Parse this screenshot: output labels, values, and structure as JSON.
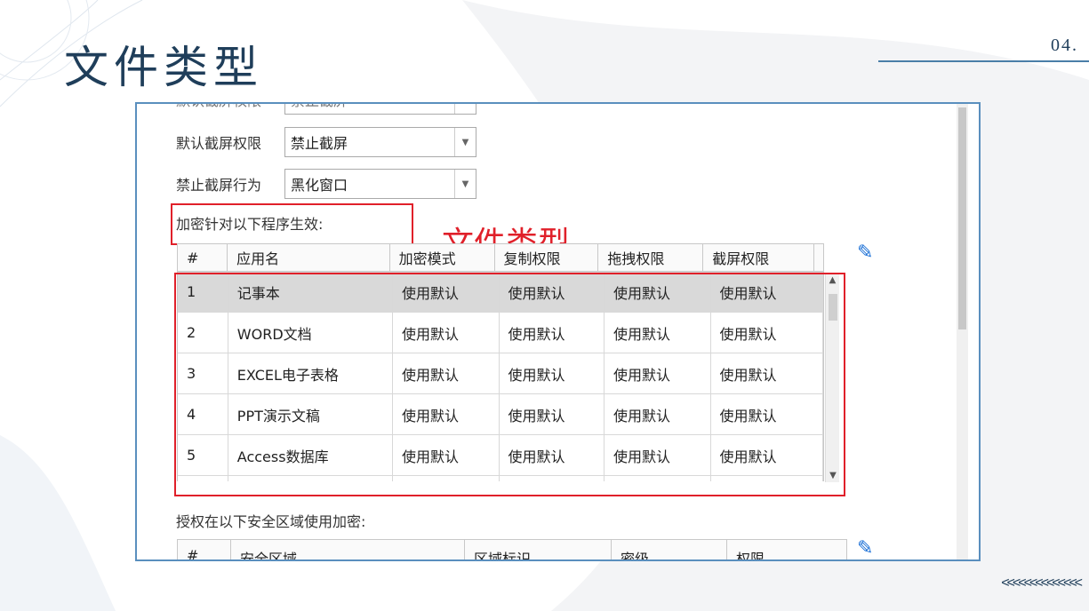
{
  "slide": {
    "title": "文件类型",
    "page_number": "04.",
    "chevrons": "<<<<<<<<<<<<<<"
  },
  "window": {
    "clipped_top_label": "默认截屏权限",
    "clipped_top_value": "禁止截屏",
    "screenshot_default": {
      "label": "默认截屏权限",
      "value": "禁止截屏"
    },
    "screenshot_behavior": {
      "label": "禁止截屏行为",
      "value": "黑化窗口"
    },
    "programs_section_label": "加密针对以下程序生效:",
    "overlay_annotation": "文件类型",
    "programs_table": {
      "headers": [
        "#",
        "应用名",
        "加密模式",
        "复制权限",
        "拖拽权限",
        "截屏权限"
      ],
      "rows": [
        {
          "num": "1",
          "app": "记事本",
          "enc": "使用默认",
          "copy": "使用默认",
          "drag": "使用默认",
          "shot": "使用默认"
        },
        {
          "num": "2",
          "app": "WORD文档",
          "enc": "使用默认",
          "copy": "使用默认",
          "drag": "使用默认",
          "shot": "使用默认"
        },
        {
          "num": "3",
          "app": "EXCEL电子表格",
          "enc": "使用默认",
          "copy": "使用默认",
          "drag": "使用默认",
          "shot": "使用默认"
        },
        {
          "num": "4",
          "app": "PPT演示文稿",
          "enc": "使用默认",
          "copy": "使用默认",
          "drag": "使用默认",
          "shot": "使用默认"
        },
        {
          "num": "5",
          "app": "Access数据库",
          "enc": "使用默认",
          "copy": "使用默认",
          "drag": "使用默认",
          "shot": "使用默认"
        }
      ]
    },
    "zones_section_label": "授权在以下安全区域使用加密:",
    "zones_table": {
      "headers": [
        "#",
        "安全区域",
        "区域标识",
        "密级",
        "权限"
      ]
    }
  },
  "colors": {
    "title": "#1f3e5a",
    "annotation_red": "#e0202a",
    "window_border": "#5a8fbe",
    "selected_row": "#d9d9d9",
    "pencil_blue": "#1a6fd6"
  },
  "icons": {
    "dropdown": "chevron-down-icon",
    "edit": "pencil-icon",
    "scroll_up": "chevron-up-icon",
    "scroll_down": "chevron-down-icon"
  }
}
